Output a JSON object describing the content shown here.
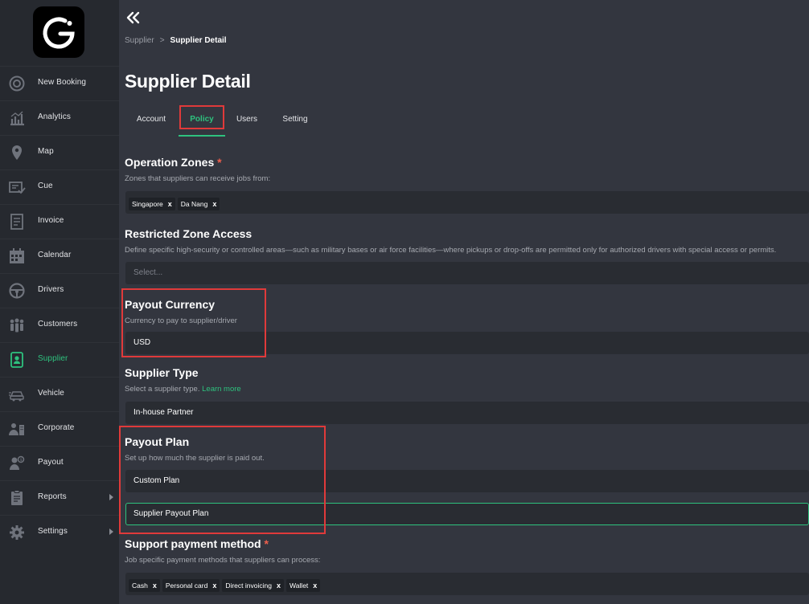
{
  "sidebar": {
    "items": [
      {
        "label": "New Booking",
        "icon": "plus-circle-icon"
      },
      {
        "label": "Analytics",
        "icon": "chart-icon"
      },
      {
        "label": "Map",
        "icon": "map-pin-icon"
      },
      {
        "label": "Cue",
        "icon": "cue-icon"
      },
      {
        "label": "Invoice",
        "icon": "invoice-icon"
      },
      {
        "label": "Calendar",
        "icon": "calendar-icon"
      },
      {
        "label": "Drivers",
        "icon": "steering-wheel-icon"
      },
      {
        "label": "Customers",
        "icon": "customers-icon"
      },
      {
        "label": "Supplier",
        "icon": "supplier-icon",
        "active": true
      },
      {
        "label": "Vehicle",
        "icon": "vehicle-icon"
      },
      {
        "label": "Corporate",
        "icon": "corporate-icon"
      },
      {
        "label": "Payout",
        "icon": "payout-icon"
      },
      {
        "label": "Reports",
        "icon": "reports-icon",
        "has_submenu": true
      },
      {
        "label": "Settings",
        "icon": "gear-icon",
        "has_submenu": true
      }
    ]
  },
  "breadcrumb": {
    "parent": "Supplier",
    "separator": ">",
    "current": "Supplier Detail"
  },
  "page": {
    "title": "Supplier Detail"
  },
  "tabs": [
    {
      "label": "Account"
    },
    {
      "label": "Policy",
      "active": true
    },
    {
      "label": "Users"
    },
    {
      "label": "Setting"
    }
  ],
  "operation_zones": {
    "title": "Operation Zones",
    "required_mark": "*",
    "description": "Zones that suppliers can receive jobs from:",
    "chips": [
      {
        "label": "Singapore"
      },
      {
        "label": "Da Nang"
      }
    ]
  },
  "restricted_zone": {
    "title": "Restricted Zone Access",
    "description": "Define specific high-security or controlled areas—such as military bases or air force facilities—where pickups or drop-offs are permitted only for authorized drivers with special access or permits.",
    "placeholder": "Select..."
  },
  "payout_currency": {
    "title": "Payout Currency",
    "description": "Currency to pay to supplier/driver",
    "value": "USD"
  },
  "supplier_type": {
    "title": "Supplier Type",
    "description": "Select a supplier type.",
    "link": "Learn more",
    "value": "In-house Partner"
  },
  "payout_plan": {
    "title": "Payout Plan",
    "description": "Set up how much the supplier is paid out.",
    "plan_type": "Custom Plan",
    "plan_name": "Supplier Payout Plan"
  },
  "support_payment": {
    "title": "Support payment method",
    "required_mark": "*",
    "description": "Job specific payment methods that suppliers can process:",
    "chips": [
      {
        "label": "Cash"
      },
      {
        "label": "Personal card"
      },
      {
        "label": "Direct invoicing"
      },
      {
        "label": "Wallet"
      }
    ]
  },
  "chip_remove": "x",
  "colors": {
    "accent": "#2ec27e",
    "highlight": "#e03a3a",
    "sidebar_bg": "#26292f",
    "main_bg": "#33363f"
  }
}
